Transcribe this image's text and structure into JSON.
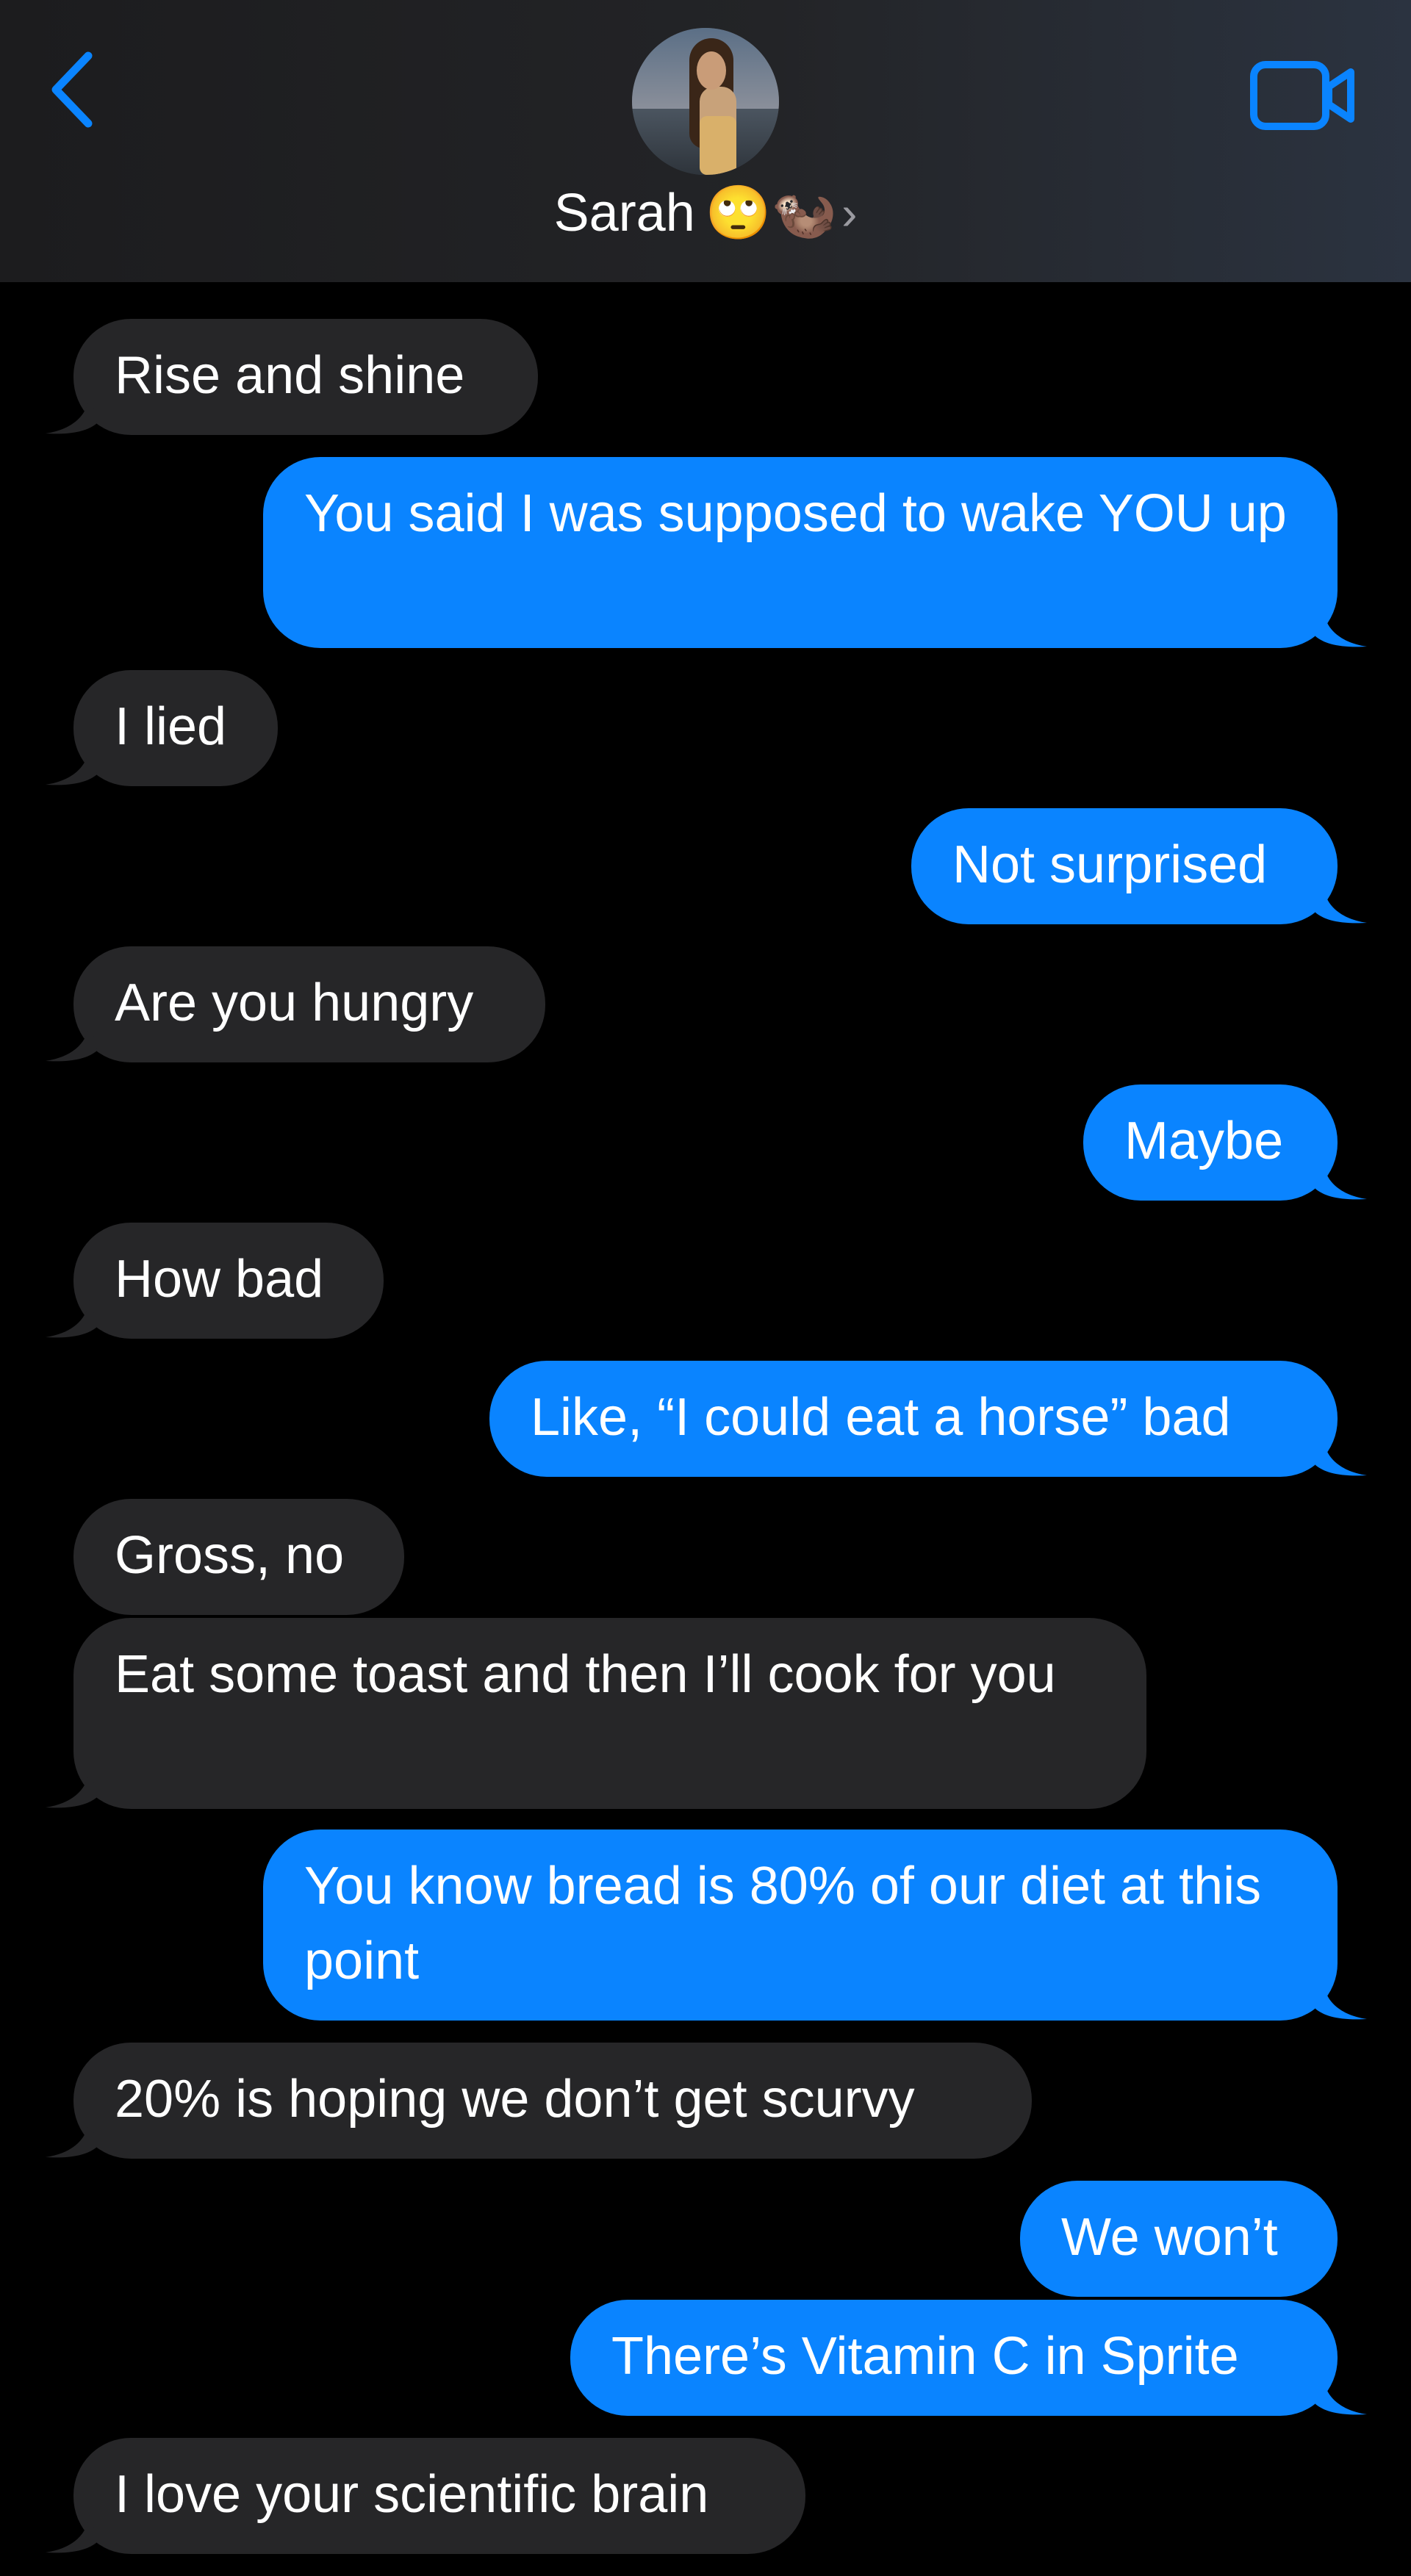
{
  "header": {
    "contact_name": "Sarah",
    "contact_emoji": "🙄🦦",
    "chevron": "›",
    "back_icon": "chevron-left-icon",
    "call_icon": "video-camera-icon"
  },
  "colors": {
    "incoming_bubble": "#262628",
    "outgoing_bubble": "#0a84ff",
    "accent": "#0a84ff",
    "background": "#000000"
  },
  "messages": [
    {
      "dir": "in",
      "text": "Rise and shine"
    },
    {
      "dir": "out",
      "text": "You said I was supposed to wake YOU up"
    },
    {
      "dir": "in",
      "text": "I lied"
    },
    {
      "dir": "out",
      "text": "Not surprised"
    },
    {
      "dir": "in",
      "text": "Are you hungry"
    },
    {
      "dir": "out",
      "text": "Maybe"
    },
    {
      "dir": "in",
      "text": "How bad"
    },
    {
      "dir": "out",
      "text": "Like, “I could eat a horse” bad"
    },
    {
      "dir": "in",
      "text": "Gross, no"
    },
    {
      "dir": "in",
      "text": "Eat some toast and then I’ll cook for you"
    },
    {
      "dir": "out",
      "text": "You know bread is 80% of our diet at this point"
    },
    {
      "dir": "in",
      "text": "20% is hoping we don’t get scurvy"
    },
    {
      "dir": "out",
      "text": "We won’t"
    },
    {
      "dir": "out",
      "text": "There’s Vitamin C in Sprite"
    },
    {
      "dir": "in",
      "text": "I love your scientific brain"
    }
  ]
}
